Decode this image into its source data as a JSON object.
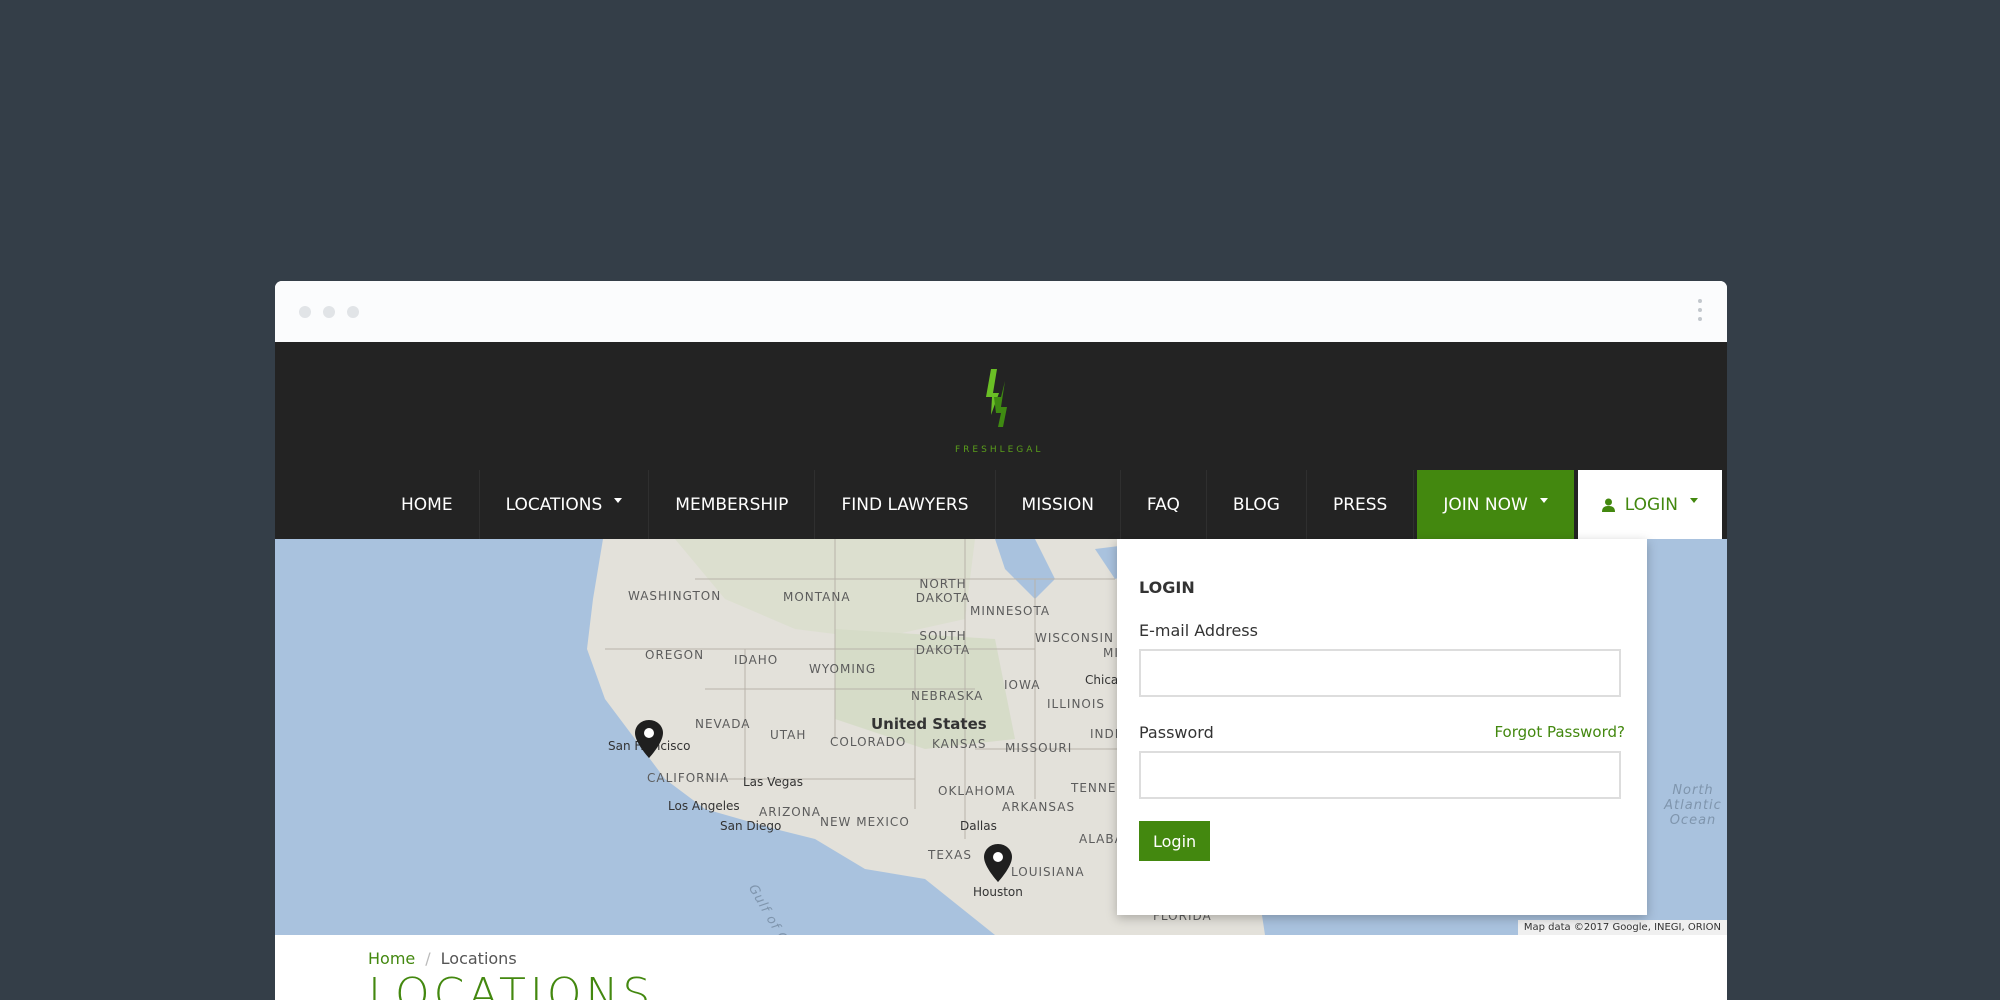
{
  "window": {
    "dots": 3
  },
  "brand": {
    "name": "FRESHLEGAL",
    "accent_color": "#43880f"
  },
  "nav": {
    "items": [
      {
        "label": "HOME"
      },
      {
        "label": "LOCATIONS",
        "has_dropdown": true
      },
      {
        "label": "MEMBERSHIP"
      },
      {
        "label": "FIND LAWYERS"
      },
      {
        "label": "MISSION"
      },
      {
        "label": "FAQ"
      },
      {
        "label": "BLOG"
      },
      {
        "label": "PRESS"
      }
    ],
    "join_label": "JOIN NOW",
    "login_label": "LOGIN"
  },
  "map": {
    "country_label": "United States",
    "states": [
      "WASHINGTON",
      "MONTANA",
      "NORTH DAKOTA",
      "MINNESOTA",
      "OREGON",
      "IDAHO",
      "SOUTH DAKOTA",
      "WISCONSIN",
      "WYOMING",
      "IOWA",
      "NEBRASKA",
      "ILLINOIS",
      "NEVADA",
      "UTAH",
      "COLORADO",
      "KANSAS",
      "MISSOURI",
      "CALIFORNIA",
      "OKLAHOMA",
      "ARIZONA",
      "NEW MEXICO",
      "ARKANSAS",
      "TEXAS",
      "LOUISIANA",
      "TENNES",
      "ALABA",
      "FLORIDA",
      "INDI",
      "MI"
    ],
    "cities": [
      "San Francisco",
      "Las Vegas",
      "Los Angeles",
      "San Diego",
      "Dallas",
      "Houston",
      "Chicago"
    ],
    "ocean_label": "North Atlantic Ocean",
    "gulf_label": "Gulf of Cali",
    "credit": "Map data ©2017 Google, INEGI, ORION"
  },
  "login_panel": {
    "title": "LOGIN",
    "email_label": "E-mail Address",
    "email_value": "",
    "password_label": "Password",
    "password_value": "",
    "forgot_label": "Forgot Password?",
    "submit_label": "Login"
  },
  "breadcrumb": {
    "home": "Home",
    "current": "Locations"
  },
  "page": {
    "title": "LOCATIONS"
  }
}
